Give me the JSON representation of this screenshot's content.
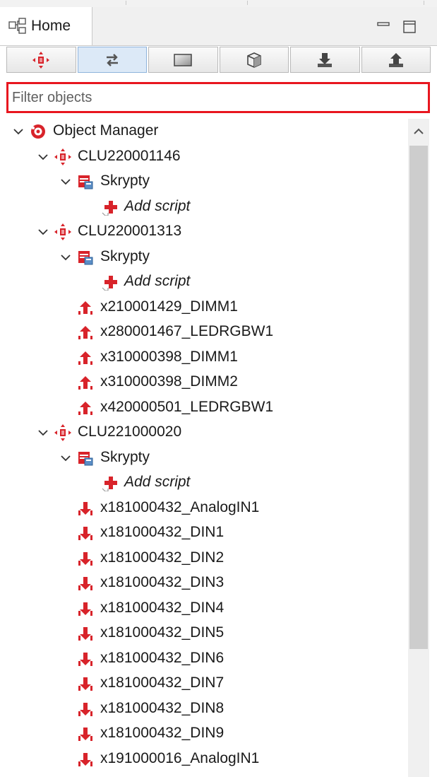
{
  "header": {
    "home_label": "Home"
  },
  "toolbar": {
    "buttons": [
      {
        "name": "clu-filter-button",
        "icon": "clu-icon",
        "active": false
      },
      {
        "name": "transfer-filter-button",
        "icon": "swap-arrows-icon",
        "active": true
      },
      {
        "name": "panel-filter-button",
        "icon": "panel-icon",
        "active": false
      },
      {
        "name": "module-filter-button",
        "icon": "cube-icon",
        "active": false
      },
      {
        "name": "input-filter-button",
        "icon": "download-arrow-icon",
        "active": false
      },
      {
        "name": "output-filter-button",
        "icon": "upload-arrow-icon",
        "active": false
      }
    ]
  },
  "filter": {
    "placeholder": "Filter objects",
    "value": ""
  },
  "tree": {
    "root": "Object Manager",
    "items": [
      {
        "label": "Object Manager",
        "icon": "object-manager-icon",
        "level": 0,
        "expanded": true,
        "italic": false
      },
      {
        "label": "CLU220001146",
        "icon": "clu-icon",
        "level": 1,
        "expanded": true,
        "italic": false
      },
      {
        "label": "Skrypty",
        "icon": "scripts-folder-icon",
        "level": 2,
        "expanded": true,
        "italic": false
      },
      {
        "label": "Add script",
        "icon": "add-script-icon",
        "level": 3,
        "expanded": null,
        "italic": true
      },
      {
        "label": "CLU220001313",
        "icon": "clu-icon",
        "level": 1,
        "expanded": true,
        "italic": false
      },
      {
        "label": "Skrypty",
        "icon": "scripts-folder-icon",
        "level": 2,
        "expanded": true,
        "italic": false
      },
      {
        "label": "Add script",
        "icon": "add-script-icon",
        "level": 3,
        "expanded": null,
        "italic": true
      },
      {
        "label": "x210001429_DIMM1",
        "icon": "output-module-icon",
        "level": 2,
        "expanded": null,
        "italic": false
      },
      {
        "label": "x280001467_LEDRGBW1",
        "icon": "output-module-icon",
        "level": 2,
        "expanded": null,
        "italic": false
      },
      {
        "label": "x310000398_DIMM1",
        "icon": "output-module-icon",
        "level": 2,
        "expanded": null,
        "italic": false
      },
      {
        "label": "x310000398_DIMM2",
        "icon": "output-module-icon",
        "level": 2,
        "expanded": null,
        "italic": false
      },
      {
        "label": "x420000501_LEDRGBW1",
        "icon": "output-module-icon",
        "level": 2,
        "expanded": null,
        "italic": false
      },
      {
        "label": "CLU221000020",
        "icon": "clu-icon",
        "level": 1,
        "expanded": true,
        "italic": false
      },
      {
        "label": "Skrypty",
        "icon": "scripts-folder-icon",
        "level": 2,
        "expanded": true,
        "italic": false
      },
      {
        "label": "Add script",
        "icon": "add-script-icon",
        "level": 3,
        "expanded": null,
        "italic": true
      },
      {
        "label": "x181000432_AnalogIN1",
        "icon": "input-module-icon",
        "level": 2,
        "expanded": null,
        "italic": false
      },
      {
        "label": "x181000432_DIN1",
        "icon": "input-module-icon",
        "level": 2,
        "expanded": null,
        "italic": false
      },
      {
        "label": "x181000432_DIN2",
        "icon": "input-module-icon",
        "level": 2,
        "expanded": null,
        "italic": false
      },
      {
        "label": "x181000432_DIN3",
        "icon": "input-module-icon",
        "level": 2,
        "expanded": null,
        "italic": false
      },
      {
        "label": "x181000432_DIN4",
        "icon": "input-module-icon",
        "level": 2,
        "expanded": null,
        "italic": false
      },
      {
        "label": "x181000432_DIN5",
        "icon": "input-module-icon",
        "level": 2,
        "expanded": null,
        "italic": false
      },
      {
        "label": "x181000432_DIN6",
        "icon": "input-module-icon",
        "level": 2,
        "expanded": null,
        "italic": false
      },
      {
        "label": "x181000432_DIN7",
        "icon": "input-module-icon",
        "level": 2,
        "expanded": null,
        "italic": false
      },
      {
        "label": "x181000432_DIN8",
        "icon": "input-module-icon",
        "level": 2,
        "expanded": null,
        "italic": false
      },
      {
        "label": "x181000432_DIN9",
        "icon": "input-module-icon",
        "level": 2,
        "expanded": null,
        "italic": false
      },
      {
        "label": "x191000016_AnalogIN1",
        "icon": "input-module-icon",
        "level": 2,
        "expanded": null,
        "italic": false
      }
    ]
  },
  "colors": {
    "accent_red": "#e8161f",
    "icon_red": "#d8232a",
    "selection_blue": "#dce9f7",
    "scroll_thumb": "#cdcdcd"
  }
}
